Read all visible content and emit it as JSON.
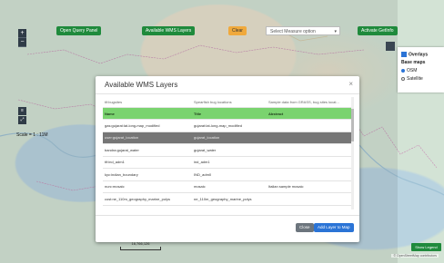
{
  "toolbar": {
    "open_query_panel": "Open Query Panel",
    "available_wms_layers": "Available WMS Layers",
    "clear": "Clear",
    "measure_select": "Select Measure option",
    "activate_getinfo": "Activate GetInfo",
    "accent_green": "#1f8a3c",
    "accent_orange": "#f0a93c"
  },
  "map": {
    "scale_text": "Scale = 1 : 11M",
    "scalebar_label": "16,766,126",
    "attribution": "© OpenStreetMap contributors",
    "show_legend": "Show Legend",
    "zoom_in": "+",
    "zoom_out": "−"
  },
  "layer_switcher": {
    "overlays": "Overlays",
    "base_maps": "Base maps",
    "osm": "OSM",
    "satellite": "Satellite"
  },
  "modal": {
    "title": "Available WMS Layers",
    "close_icon": "×",
    "columns": [
      "Name",
      "Title",
      "Abstract"
    ],
    "first_row": [
      "tif:bugsites",
      "Spearfish bug locations",
      "Sample data from GRASS, bug sites locat..."
    ],
    "rows": [
      [
        "gas:gujarat:lat-long-map_modified",
        "gujarat:lat-long-map_modified",
        ""
      ],
      [
        "user:gujarat_location",
        "gujarat_location",
        ""
      ],
      [
        "bandra:gujarat_water",
        "gujarat_water",
        ""
      ],
      [
        "tif:ind_adm1",
        "ind_adm1",
        ""
      ],
      [
        "kyc:indian_boundary",
        "IND_adm0",
        ""
      ],
      [
        "nurc:mosaic",
        "mosaic",
        "Italian sample mosaic"
      ],
      [
        "cost:ne_110m_geography_marine_polys",
        "ne_110m_geography_marine_polys",
        ""
      ]
    ],
    "active_row": 1,
    "close_button": "Close",
    "add_button": "Add Layer to Map",
    "header_color": "#7ad36f"
  }
}
